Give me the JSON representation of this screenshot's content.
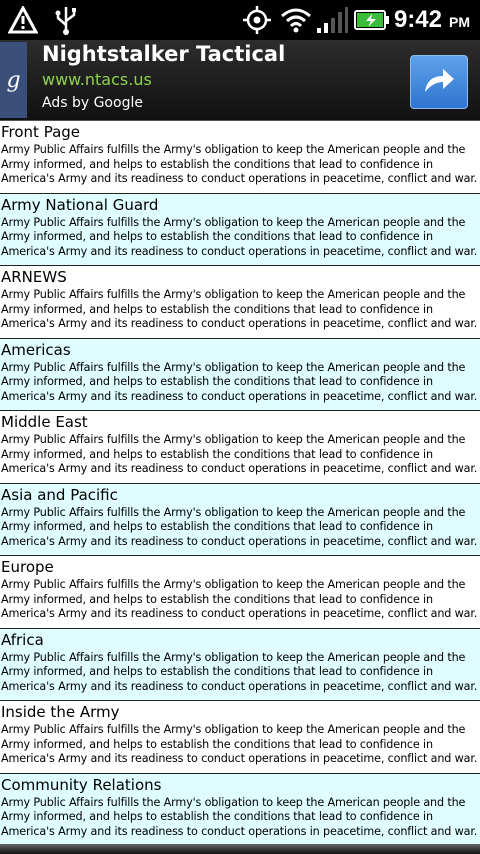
{
  "status_bar": {
    "time": "9:42",
    "ampm": "PM",
    "icons": [
      "warning-icon",
      "usb-icon",
      "gps-icon",
      "wifi-icon",
      "signal-icon",
      "battery-icon"
    ]
  },
  "ad": {
    "badge": "g",
    "title": "Nightstalker Tactical",
    "url": "www.ntacs.us",
    "by": "Ads by Google",
    "accent": "#8fd14f"
  },
  "items": [
    {
      "title": "Front Page",
      "desc": "Army Public Affairs fulfills the Army's obligation to keep the American people and the Army informed, and  helps to establish the conditions that lead to confidence in America's Army and its readiness to conduct operations in peacetime, conflict and war."
    },
    {
      "title": "Army National Guard",
      "desc": "Army Public Affairs fulfills the Army's obligation to keep the American people and the Army informed, and  helps to establish the conditions that lead to confidence in America's Army and its readiness to conduct operations in peacetime, conflict and war."
    },
    {
      "title": "ARNEWS",
      "desc": "Army Public Affairs fulfills the Army's obligation to keep the American people and the Army informed, and  helps to establish the conditions that lead to confidence in America's Army and its readiness to conduct operations in peacetime, conflict and war."
    },
    {
      "title": "Americas",
      "desc": "Army Public Affairs fulfills the Army's obligation to keep the American people and the Army informed, and  helps to establish the conditions that lead to confidence in America's Army and its readiness to conduct operations in peacetime, conflict and war."
    },
    {
      "title": "Middle East",
      "desc": "Army Public Affairs fulfills the Army's obligation to keep the American people and the Army informed, and  helps to establish the conditions that lead to confidence in America's Army and its readiness to conduct operations in peacetime, conflict and war."
    },
    {
      "title": "Asia and Pacific",
      "desc": "Army Public Affairs fulfills the Army's obligation to keep the American people and the Army informed, and  helps to establish the conditions that lead to confidence in America's Army and its readiness to conduct operations in peacetime, conflict and war."
    },
    {
      "title": "Europe",
      "desc": "Army Public Affairs fulfills the Army's obligation to keep the American people and the Army informed, and  helps to establish the conditions that lead to confidence in America's Army and its readiness to conduct operations in peacetime, conflict and war."
    },
    {
      "title": "Africa",
      "desc": "Army Public Affairs fulfills the Army's obligation to keep the American people and the Army informed, and  helps to establish the conditions that lead to confidence in America's Army and its readiness to conduct operations in peacetime, conflict and war."
    },
    {
      "title": "Inside the Army",
      "desc": "Army Public Affairs fulfills the Army's obligation to keep the American people and the Army informed, and  helps to establish the conditions that lead to confidence in America's Army and its readiness to conduct operations in peacetime, conflict and war."
    },
    {
      "title": "Community Relations",
      "desc": "Army Public Affairs fulfills the Army's obligation to keep the American people and the Army informed, and  helps to establish the conditions that lead to confidence in America's Army and its readiness to conduct operations in peacetime, conflict and war."
    }
  ],
  "colors": {
    "alt_row": "#dffcff",
    "row": "#ffffff",
    "divider": "#222222"
  }
}
